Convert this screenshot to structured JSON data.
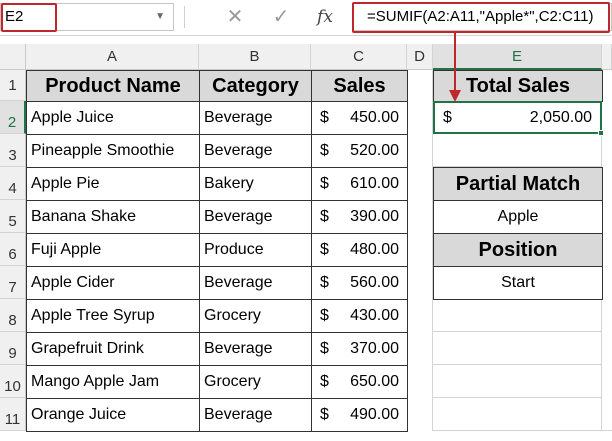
{
  "name_box": {
    "value": "E2"
  },
  "formula_bar": {
    "cancel_icon": "✕",
    "enter_icon": "✓",
    "fx_label": "fx",
    "formula": "=SUMIF(A2:A11,\"Apple*\",C2:C11)"
  },
  "columns": [
    "A",
    "B",
    "C",
    "D",
    "E"
  ],
  "rows": [
    "1",
    "2",
    "3",
    "4",
    "5",
    "6",
    "7",
    "8",
    "9",
    "10",
    "11"
  ],
  "table": {
    "headers": {
      "product": "Product Name",
      "category": "Category",
      "sales": "Sales"
    },
    "currency_symbol": "$",
    "records": [
      {
        "product": "Apple Juice",
        "category": "Beverage",
        "sales": "450.00"
      },
      {
        "product": "Pineapple Smoothie",
        "category": "Beverage",
        "sales": "520.00"
      },
      {
        "product": "Apple Pie",
        "category": "Bakery",
        "sales": "610.00"
      },
      {
        "product": "Banana Shake",
        "category": "Beverage",
        "sales": "390.00"
      },
      {
        "product": "Fuji Apple",
        "category": "Produce",
        "sales": "480.00"
      },
      {
        "product": "Apple Cider",
        "category": "Beverage",
        "sales": "560.00"
      },
      {
        "product": "Apple Tree Syrup",
        "category": "Grocery",
        "sales": "430.00"
      },
      {
        "product": "Grapefruit Drink",
        "category": "Beverage",
        "sales": "370.00"
      },
      {
        "product": "Mango Apple Jam",
        "category": "Grocery",
        "sales": "650.00"
      },
      {
        "product": "Orange Juice",
        "category": "Beverage",
        "sales": "490.00"
      }
    ]
  },
  "summary": {
    "total_sales_label": "Total Sales",
    "currency_symbol": "$",
    "total_sales_value": "2,050.00",
    "partial_match_label": "Partial Match",
    "partial_match_value": "Apple",
    "position_label": "Position",
    "position_value": "Start"
  },
  "colors": {
    "highlight": "#c0272d",
    "selection": "#217346",
    "header_fill": "#d9d9d9"
  }
}
